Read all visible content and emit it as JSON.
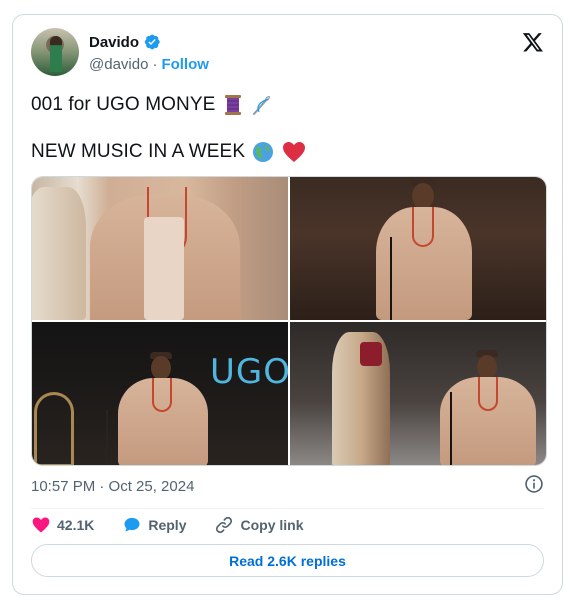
{
  "author": {
    "display_name": "Davido",
    "handle": "@davido",
    "separator": "·",
    "follow_label": "Follow"
  },
  "tweet": {
    "line1": "001 for UGO MONYE",
    "line1_emojis": [
      "spool-of-thread-emoji",
      "sewing-needle-emoji"
    ],
    "line2": "NEW MUSIC IN A WEEK",
    "line2_emojis": [
      "globe-emoji",
      "red-heart-emoji"
    ]
  },
  "media": {
    "photos": [
      {
        "name": "photo-1"
      },
      {
        "name": "photo-2"
      },
      {
        "name": "photo-3",
        "overlay_text": "UGO"
      },
      {
        "name": "photo-4"
      }
    ]
  },
  "meta": {
    "timestamp": "10:57 PM · Oct 25, 2024"
  },
  "actions": {
    "likes": "42.1K",
    "reply_label": "Reply",
    "copy_link_label": "Copy link"
  },
  "read_replies_label": "Read 2.6K replies",
  "colors": {
    "accent": "#1d9bf0",
    "like": "#f91880",
    "reply_button_text": "#006fd6",
    "secondary_text": "#536471",
    "border": "#cfd9de"
  }
}
